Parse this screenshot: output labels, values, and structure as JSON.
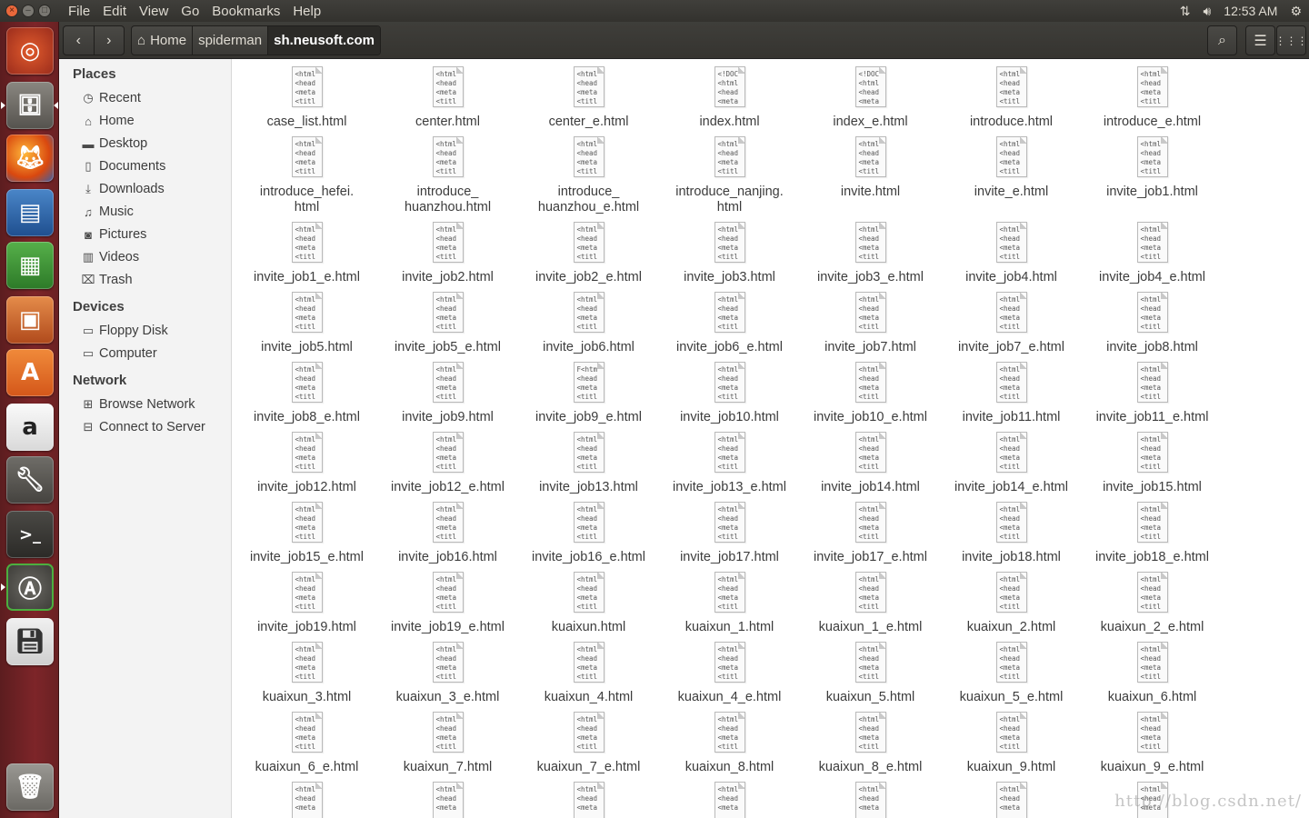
{
  "menubar": {
    "items": [
      "File",
      "Edit",
      "View",
      "Go",
      "Bookmarks",
      "Help"
    ],
    "clock": "12:53 AM"
  },
  "toolbar": {
    "breadcrumbs": [
      "Home",
      "spiderman",
      "sh.neusoft.com"
    ]
  },
  "sidebar": {
    "places_title": "Places",
    "places": [
      {
        "label": "Recent",
        "icon": "clock-icon"
      },
      {
        "label": "Home",
        "icon": "home-icon"
      },
      {
        "label": "Desktop",
        "icon": "folder-icon"
      },
      {
        "label": "Documents",
        "icon": "document-icon"
      },
      {
        "label": "Downloads",
        "icon": "download-icon"
      },
      {
        "label": "Music",
        "icon": "music-icon"
      },
      {
        "label": "Pictures",
        "icon": "camera-icon"
      },
      {
        "label": "Videos",
        "icon": "film-icon"
      },
      {
        "label": "Trash",
        "icon": "trash-icon"
      }
    ],
    "devices_title": "Devices",
    "devices": [
      {
        "label": "Floppy Disk",
        "icon": "drive-icon"
      },
      {
        "label": "Computer",
        "icon": "drive-icon"
      }
    ],
    "network_title": "Network",
    "network": [
      {
        "label": "Browse Network",
        "icon": "network-icon"
      },
      {
        "label": "Connect to Server",
        "icon": "server-icon"
      }
    ]
  },
  "files": [
    {
      "name": "case_list.html",
      "preview": "<html\n<head\n<meta\n<titl"
    },
    {
      "name": "center.html",
      "preview": "<html\n<head\n<meta\n<titl"
    },
    {
      "name": "center_e.html",
      "preview": "<html\n<head\n<meta\n<titl"
    },
    {
      "name": "index.html",
      "preview": "<!DOC\n<html\n<head\n<meta"
    },
    {
      "name": "index_e.html",
      "preview": "<!DOC\n<html\n<head\n<meta"
    },
    {
      "name": "introduce.html",
      "preview": "<html\n<head\n<meta\n<titl"
    },
    {
      "name": "introduce_e.html",
      "preview": "<html\n<head\n<meta\n<titl"
    },
    {
      "name": "introduce_hefei.\nhtml",
      "preview": "<html\n<head\n<meta\n<titl"
    },
    {
      "name": "introduce_\nhuanzhou.html",
      "preview": "<html\n<head\n<meta\n<titl"
    },
    {
      "name": "introduce_\nhuanzhou_e.html",
      "preview": "<html\n<head\n<meta\n<titl"
    },
    {
      "name": "introduce_nanjing.\nhtml",
      "preview": "<html\n<head\n<meta\n<titl"
    },
    {
      "name": "invite.html",
      "preview": "<html\n<head\n<meta\n<titl"
    },
    {
      "name": "invite_e.html",
      "preview": "<html\n<head\n<meta\n<titl"
    },
    {
      "name": "invite_job1.html",
      "preview": "<html\n<head\n<meta\n<titl"
    },
    {
      "name": "invite_job1_e.html",
      "preview": "<html\n<head\n<meta\n<titl"
    },
    {
      "name": "invite_job2.html",
      "preview": "<html\n<head\n<meta\n<titl"
    },
    {
      "name": "invite_job2_e.html",
      "preview": "<html\n<head\n<meta\n<titl"
    },
    {
      "name": "invite_job3.html",
      "preview": "<html\n<head\n<meta\n<titl"
    },
    {
      "name": "invite_job3_e.html",
      "preview": "<html\n<head\n<meta\n<titl"
    },
    {
      "name": "invite_job4.html",
      "preview": "<html\n<head\n<meta\n<titl"
    },
    {
      "name": "invite_job4_e.html",
      "preview": "<html\n<head\n<meta\n<titl"
    },
    {
      "name": "invite_job5.html",
      "preview": "<html\n<head\n<meta\n<titl"
    },
    {
      "name": "invite_job5_e.html",
      "preview": "<html\n<head\n<meta\n<titl"
    },
    {
      "name": "invite_job6.html",
      "preview": "<html\n<head\n<meta\n<titl"
    },
    {
      "name": "invite_job6_e.html",
      "preview": "<html\n<head\n<meta\n<titl"
    },
    {
      "name": "invite_job7.html",
      "preview": "<html\n<head\n<meta\n<titl"
    },
    {
      "name": "invite_job7_e.html",
      "preview": "<html\n<head\n<meta\n<titl"
    },
    {
      "name": "invite_job8.html",
      "preview": "<html\n<head\n<meta\n<titl"
    },
    {
      "name": "invite_job8_e.html",
      "preview": "<html\n<head\n<meta\n<titl"
    },
    {
      "name": "invite_job9.html",
      "preview": "<html\n<head\n<meta\n<titl"
    },
    {
      "name": "invite_job9_e.html",
      "preview": "F<htm\n<head\n<meta\n<titl"
    },
    {
      "name": "invite_job10.html",
      "preview": "<html\n<head\n<meta\n<titl"
    },
    {
      "name": "invite_job10_e.html",
      "preview": "<html\n<head\n<meta\n<titl"
    },
    {
      "name": "invite_job11.html",
      "preview": "<html\n<head\n<meta\n<titl"
    },
    {
      "name": "invite_job11_e.html",
      "preview": "<html\n<head\n<meta\n<titl"
    },
    {
      "name": "invite_job12.html",
      "preview": "<html\n<head\n<meta\n<titl"
    },
    {
      "name": "invite_job12_e.html",
      "preview": "<html\n<head\n<meta\n<titl"
    },
    {
      "name": "invite_job13.html",
      "preview": "<html\n<head\n<meta\n<titl"
    },
    {
      "name": "invite_job13_e.html",
      "preview": "<html\n<head\n<meta\n<titl"
    },
    {
      "name": "invite_job14.html",
      "preview": "<html\n<head\n<meta\n<titl"
    },
    {
      "name": "invite_job14_e.html",
      "preview": "<html\n<head\n<meta\n<titl"
    },
    {
      "name": "invite_job15.html",
      "preview": "<html\n<head\n<meta\n<titl"
    },
    {
      "name": "invite_job15_e.html",
      "preview": "<html\n<head\n<meta\n<titl"
    },
    {
      "name": "invite_job16.html",
      "preview": "<html\n<head\n<meta\n<titl"
    },
    {
      "name": "invite_job16_e.html",
      "preview": "<html\n<head\n<meta\n<titl"
    },
    {
      "name": "invite_job17.html",
      "preview": "<html\n<head\n<meta\n<titl"
    },
    {
      "name": "invite_job17_e.html",
      "preview": "<html\n<head\n<meta\n<titl"
    },
    {
      "name": "invite_job18.html",
      "preview": "<html\n<head\n<meta\n<titl"
    },
    {
      "name": "invite_job18_e.html",
      "preview": "<html\n<head\n<meta\n<titl"
    },
    {
      "name": "invite_job19.html",
      "preview": "<html\n<head\n<meta\n<titl"
    },
    {
      "name": "invite_job19_e.html",
      "preview": "<html\n<head\n<meta\n<titl"
    },
    {
      "name": "kuaixun.html",
      "preview": "<html\n<head\n<meta\n<titl"
    },
    {
      "name": "kuaixun_1.html",
      "preview": "<html\n<head\n<meta\n<titl"
    },
    {
      "name": "kuaixun_1_e.html",
      "preview": "<html\n<head\n<meta\n<titl"
    },
    {
      "name": "kuaixun_2.html",
      "preview": "<html\n<head\n<meta\n<titl"
    },
    {
      "name": "kuaixun_2_e.html",
      "preview": "<html\n<head\n<meta\n<titl"
    },
    {
      "name": "kuaixun_3.html",
      "preview": "<html\n<head\n<meta\n<titl"
    },
    {
      "name": "kuaixun_3_e.html",
      "preview": "<html\n<head\n<meta\n<titl"
    },
    {
      "name": "kuaixun_4.html",
      "preview": "<html\n<head\n<meta\n<titl"
    },
    {
      "name": "kuaixun_4_e.html",
      "preview": "<html\n<head\n<meta\n<titl"
    },
    {
      "name": "kuaixun_5.html",
      "preview": "<html\n<head\n<meta\n<titl"
    },
    {
      "name": "kuaixun_5_e.html",
      "preview": "<html\n<head\n<meta\n<titl"
    },
    {
      "name": "kuaixun_6.html",
      "preview": "<html\n<head\n<meta\n<titl"
    },
    {
      "name": "kuaixun_6_e.html",
      "preview": "<html\n<head\n<meta\n<titl"
    },
    {
      "name": "kuaixun_7.html",
      "preview": "<html\n<head\n<meta\n<titl"
    },
    {
      "name": "kuaixun_7_e.html",
      "preview": "<html\n<head\n<meta\n<titl"
    },
    {
      "name": "kuaixun_8.html",
      "preview": "<html\n<head\n<meta\n<titl"
    },
    {
      "name": "kuaixun_8_e.html",
      "preview": "<html\n<head\n<meta\n<titl"
    },
    {
      "name": "kuaixun_9.html",
      "preview": "<html\n<head\n<meta\n<titl"
    },
    {
      "name": "kuaixun_9_e.html",
      "preview": "<html\n<head\n<meta\n<titl"
    },
    {
      "name": "",
      "preview": "<html\n<head\n<meta"
    },
    {
      "name": "",
      "preview": "<html\n<head\n<meta"
    },
    {
      "name": "",
      "preview": "<html\n<head\n<meta"
    },
    {
      "name": "",
      "preview": "<html\n<head\n<meta"
    },
    {
      "name": "",
      "preview": "<html\n<head\n<meta"
    },
    {
      "name": "",
      "preview": "<html\n<head\n<meta"
    },
    {
      "name": "",
      "preview": "<html\n<head\n<meta"
    }
  ],
  "watermark": "http://blog.csdn.net/",
  "colors": {
    "launcher": "#7d2529",
    "topbar": "#3c3b37",
    "accent": "#e9683b"
  }
}
